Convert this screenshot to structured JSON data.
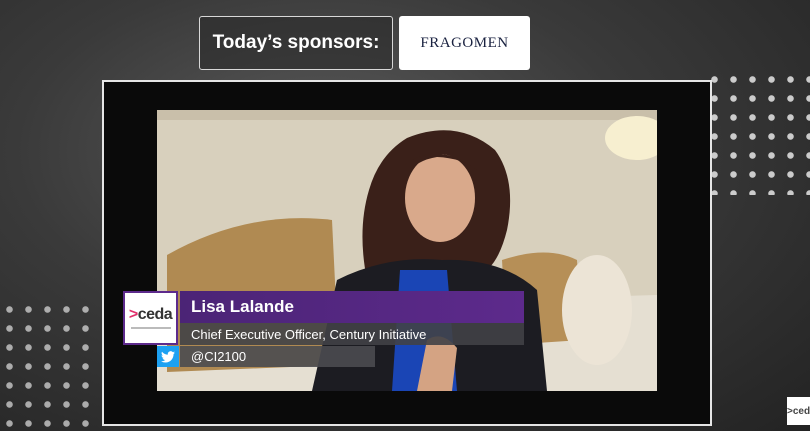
{
  "sponsors": {
    "label": "Today’s sponsors:",
    "logo_text": "FRAGOMEN"
  },
  "lower_third": {
    "name": "Lisa Lalande",
    "title": "Chief Executive Officer, Century Initiative",
    "twitter_handle": "@CI2100"
  },
  "brand": {
    "logo_prefix": ">",
    "logo_text": "ceda",
    "corner_text": ">ceda"
  },
  "icons": {
    "twitter": "twitter-icon"
  },
  "colors": {
    "name_bar": "#5d2a8c",
    "twitter_blue": "#1da1f2",
    "brand_accent": "#e1306c"
  }
}
